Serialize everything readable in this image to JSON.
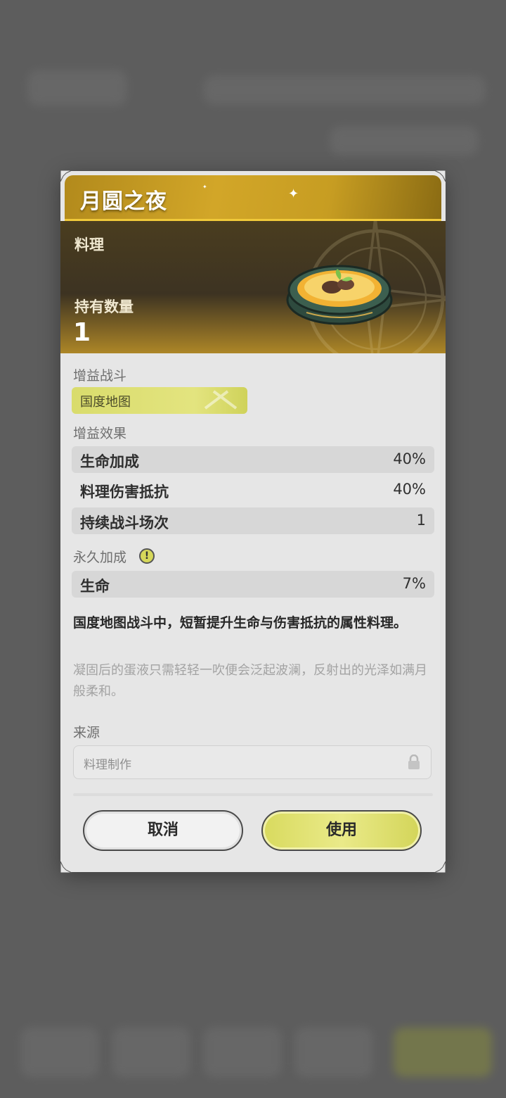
{
  "item": {
    "title": "月圆之夜",
    "category": "料理",
    "owned_label": "持有数量",
    "owned_value": "1"
  },
  "buff_battle": {
    "label": "增益战斗",
    "tag": "国度地图"
  },
  "buff_effects": {
    "label": "增益效果",
    "rows": [
      {
        "name": "生命加成",
        "value": "40%"
      },
      {
        "name": "料理伤害抵抗",
        "value": "40%"
      },
      {
        "name": "持续战斗场次",
        "value": "1"
      }
    ]
  },
  "permanent": {
    "label": "永久加成",
    "rows": [
      {
        "name": "生命",
        "value": "7%"
      }
    ]
  },
  "description": "国度地图战斗中，短暂提升生命与伤害抵抗的属性料理。",
  "flavor_text": "凝固后的蛋液只需轻轻一吹便会泛起波澜，反射出的光泽如满月般柔和。",
  "source": {
    "label": "来源",
    "value": "料理制作"
  },
  "buttons": {
    "cancel": "取消",
    "use": "使用"
  },
  "colors": {
    "accent_yellow": "#e3e47f",
    "title_gold": "#d2a628"
  }
}
